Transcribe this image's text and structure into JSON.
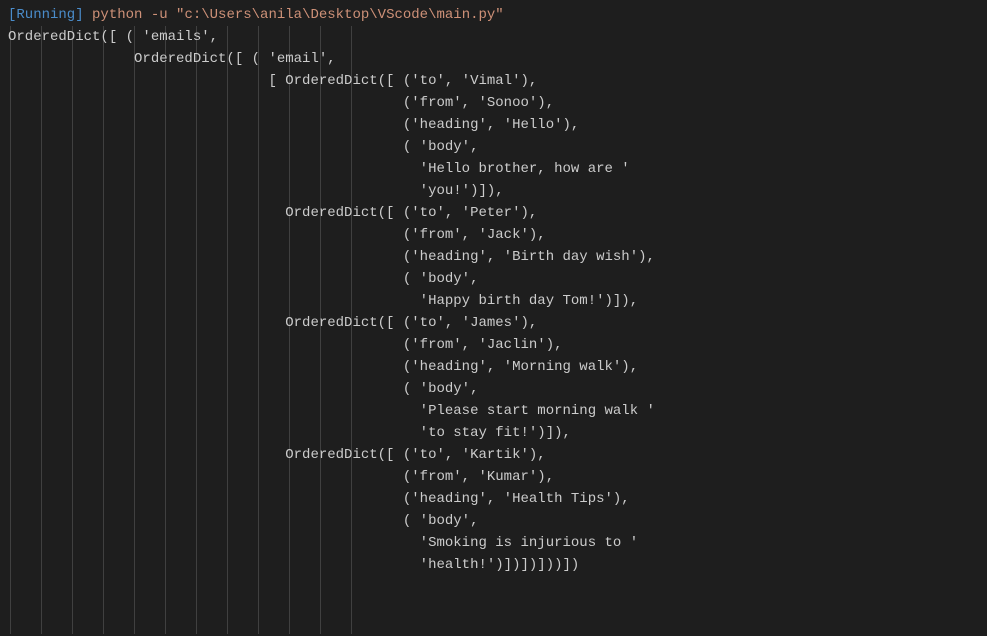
{
  "header": {
    "running_tag": "[Running]",
    "command": "python -u \"c:\\Users\\anila\\Desktop\\VScode\\main.py\""
  },
  "output_lines": [
    "OrderedDict([ ( 'emails',",
    "               OrderedDict([ ( 'email',",
    "                               [ OrderedDict([ ('to', 'Vimal'),",
    "                                               ('from', 'Sonoo'),",
    "                                               ('heading', 'Hello'),",
    "                                               ( 'body',",
    "                                                 'Hello brother, how are '",
    "                                                 'you!')]),",
    "                                 OrderedDict([ ('to', 'Peter'),",
    "                                               ('from', 'Jack'),",
    "                                               ('heading', 'Birth day wish'),",
    "                                               ( 'body',",
    "                                                 'Happy birth day Tom!')]),",
    "                                 OrderedDict([ ('to', 'James'),",
    "                                               ('from', 'Jaclin'),",
    "                                               ('heading', 'Morning walk'),",
    "                                               ( 'body',",
    "                                                 'Please start morning walk '",
    "                                                 'to stay fit!')]),",
    "                                 OrderedDict([ ('to', 'Kartik'),",
    "                                               ('from', 'Kumar'),",
    "                                               ('heading', 'Health Tips'),",
    "                                               ( 'body',",
    "                                                 'Smoking is injurious to '",
    "                                                 'health!')])])]))])"
  ]
}
